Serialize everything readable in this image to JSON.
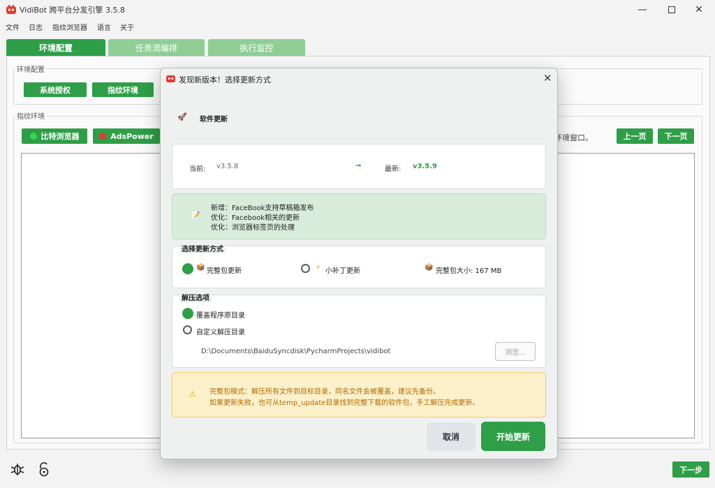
{
  "window": {
    "title": "VidiBot 跨平台分发引擎 3.5.8"
  },
  "menu": [
    "文件",
    "日志",
    "指纹浏览器",
    "语言",
    "关于"
  ],
  "tabs": [
    "环境配置",
    "任务流编排",
    "执行监控"
  ],
  "env_config": {
    "group_label": "环境配置",
    "system_auth": "系统授权",
    "fingerprint_env": "指纹环境"
  },
  "fingerprint": {
    "group_label": "指纹环境",
    "bit_browser": "比特浏览器",
    "adspower": "AdsPower",
    "hint_tail": "环境窗口。",
    "prev_page": "上一页",
    "next_page": "下一页"
  },
  "footer": {
    "next_step": "下一步"
  },
  "dialog": {
    "title": "发现新版本！选择更新方式",
    "section_title": "软件更新",
    "current_label": "当前:",
    "current_version": "v3.5.8",
    "arrow": "→",
    "latest_label": "最新:",
    "latest_version": "v3.5.9",
    "release_notes": [
      "新增：FaceBook支持草稿箱发布",
      "优化：Facebook相关的更新",
      "优化：浏览器标签页的处理"
    ],
    "update_mode_label": "选择更新方式",
    "full_package": "完整包更新",
    "patch": "小补丁更新",
    "package_size": "完整包大小: 167 MB",
    "extract_label": "解压选项",
    "overwrite_dir": "覆盖程序原目录",
    "custom_dir": "自定义解压目录",
    "path": "D:\\Documents\\BaiduSyncdisk\\PycharmProjects\\vidibot",
    "browse": "浏览...",
    "warning_line1": "完整包模式：解压所有文件到目标目录，同名文件会被覆盖，建议先备份。",
    "warning_line2": "如果更新失败，也可从temp_update目录找到完整下载的软件包，手工解压完成更新。",
    "cancel": "取消",
    "start_update": "开始更新"
  },
  "colors": {
    "accent": "#2e9e47",
    "tab_inactive": "#8fcf96",
    "warning_bg": "#fdf1cc",
    "notes_bg": "#d8ecdc"
  },
  "icons": [
    "app-logo-icon",
    "minimize-icon",
    "maximize-icon",
    "close-icon",
    "rocket-icon",
    "notes-icon",
    "package-icon",
    "lightning-icon",
    "warning-icon",
    "bug-icon",
    "unlock-icon"
  ]
}
